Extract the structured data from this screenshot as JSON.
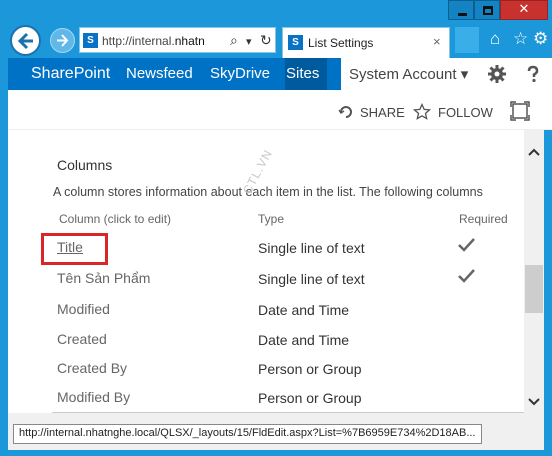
{
  "browser": {
    "address_prefix": "http://internal.",
    "address_bold": "nhatn",
    "tab_title": "List Settings",
    "tab_close": "×",
    "window_buttons": {
      "close": "✕"
    }
  },
  "suite_bar": {
    "brand": "SharePoint",
    "nav": [
      "Newsfeed",
      "SkyDrive",
      "Sites"
    ],
    "account": "System Account ▾"
  },
  "ribbon": {
    "share": "SHARE",
    "follow": "FOLLOW"
  },
  "columns_section": {
    "heading": "Columns",
    "description": "A column stores information about each item in the list. The following columns",
    "headers": {
      "column": "Column (click to edit)",
      "type": "Type",
      "required": "Required"
    },
    "rows": [
      {
        "name": "Title",
        "type": "Single line of text",
        "required": true
      },
      {
        "name": "Tên Sản Phẩm",
        "type": "Single line of text",
        "required": true
      },
      {
        "name": "Modified",
        "type": "Date and Time",
        "required": false
      },
      {
        "name": "Created",
        "type": "Date and Time",
        "required": false
      },
      {
        "name": "Created By",
        "type": "Person or Group",
        "required": false
      },
      {
        "name": "Modified By",
        "type": "Person or Group",
        "required": false
      }
    ]
  },
  "watermark": "CTL.VN",
  "status_url": "http://internal.nhatnghe.local/QLSX/_layouts/15/FldEdit.aspx?List=%7B6959E734%2D18AB...",
  "colors": {
    "suite_blue": "#0072c6",
    "chrome_blue": "#1c97d9",
    "highlight_red": "#d92626"
  }
}
